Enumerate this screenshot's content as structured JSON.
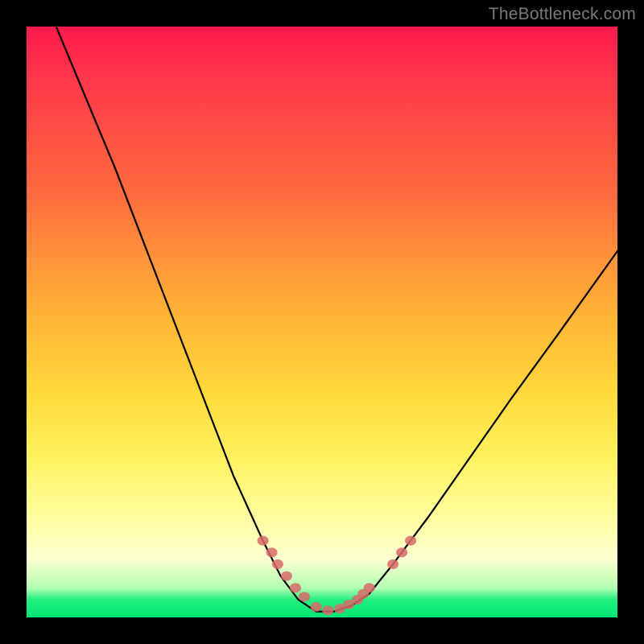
{
  "watermark": "TheBottleneck.com",
  "chart_data": {
    "type": "line",
    "title": "",
    "xlabel": "",
    "ylabel": "",
    "xlim": [
      0,
      100
    ],
    "ylim": [
      0,
      100
    ],
    "series": [
      {
        "name": "bottleneck-curve",
        "x": [
          5,
          10,
          15,
          20,
          25,
          30,
          35,
          40,
          43,
          46,
          49,
          52,
          55,
          58,
          62,
          68,
          75,
          82,
          90,
          100
        ],
        "values": [
          100,
          88,
          76,
          63,
          50,
          37,
          24,
          13,
          7,
          3,
          1,
          1,
          2,
          4,
          9,
          17,
          27,
          37,
          48,
          62
        ]
      }
    ],
    "markers": {
      "name": "highlight-dots",
      "x": [
        40,
        41.5,
        42.5,
        44,
        45.5,
        47,
        49,
        51,
        53,
        54.5,
        56,
        57,
        58,
        62,
        63.5,
        65
      ],
      "values": [
        13,
        11,
        9,
        7,
        5,
        3.5,
        1.8,
        1.2,
        1.5,
        2.2,
        3,
        4,
        5,
        9,
        11,
        13
      ]
    },
    "gradient_stops": [
      {
        "pct": 0,
        "color": "#ff1a4b"
      },
      {
        "pct": 40,
        "color": "#ff963a"
      },
      {
        "pct": 72,
        "color": "#fff05a"
      },
      {
        "pct": 95,
        "color": "#b3ffb0"
      },
      {
        "pct": 100,
        "color": "#00e472"
      }
    ]
  }
}
